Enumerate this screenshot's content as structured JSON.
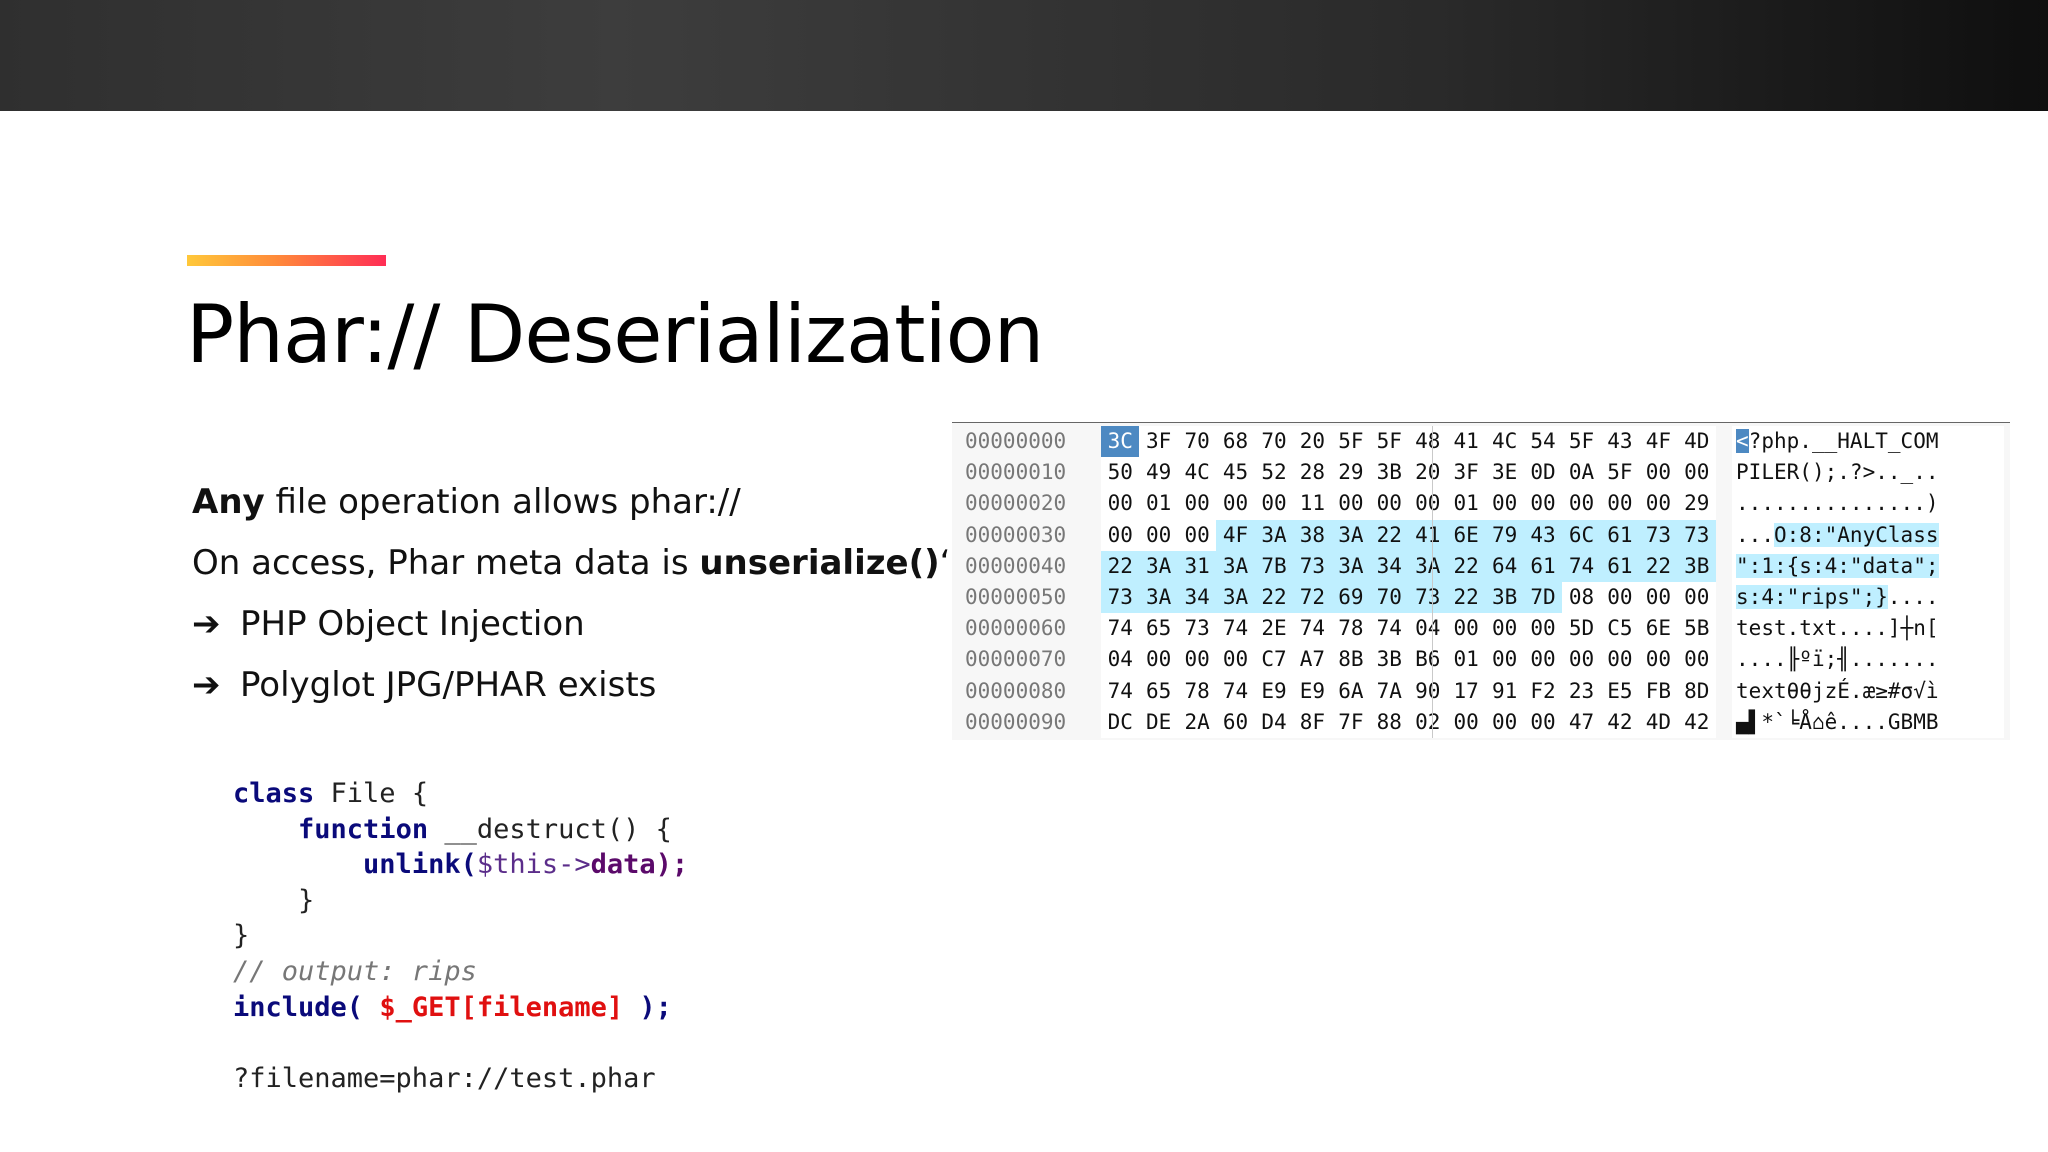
{
  "slide": {
    "title": "Phar:// Deserialization",
    "bullets": [
      {
        "prefix_bold": "Any",
        "text": " file operation allows phar://"
      },
      {
        "text": "On access, Phar meta data is ",
        "bold": "unserialize()",
        "suffix": "‘d"
      },
      {
        "arrow": "➔",
        "text": "PHP Object Injection"
      },
      {
        "arrow": "➔",
        "text": "Polyglot JPG/PHAR exists"
      }
    ],
    "code": {
      "line1_kw": "class",
      "line1_rest": " File {",
      "line2_kw": "function",
      "line2_rest": " __destruct() {",
      "line3_fn": "unlink(",
      "line3_var": "$this->",
      "line3_prop": "data);",
      "line3_end": ";",
      "line4": "}",
      "line5": "}",
      "line6_comment": "// output: rips",
      "line7_kw": "include(",
      "line7_red": "$_GET[filename]",
      "line7_end": " );",
      "line9": "?filename=phar://test.phar"
    }
  },
  "hex_view": {
    "offsets": [
      "00000000",
      "00000010",
      "00000020",
      "00000030",
      "00000040",
      "00000050",
      "00000060",
      "00000070",
      "00000080",
      "00000090"
    ],
    "rows": [
      [
        "3C",
        "3F",
        "70",
        "68",
        "70",
        "20",
        "5F",
        "5F",
        "48",
        "41",
        "4C",
        "54",
        "5F",
        "43",
        "4F",
        "4D"
      ],
      [
        "50",
        "49",
        "4C",
        "45",
        "52",
        "28",
        "29",
        "3B",
        "20",
        "3F",
        "3E",
        "0D",
        "0A",
        "5F",
        "00",
        "00"
      ],
      [
        "00",
        "01",
        "00",
        "00",
        "00",
        "11",
        "00",
        "00",
        "00",
        "01",
        "00",
        "00",
        "00",
        "00",
        "00",
        "29"
      ],
      [
        "00",
        "00",
        "00",
        "4F",
        "3A",
        "38",
        "3A",
        "22",
        "41",
        "6E",
        "79",
        "43",
        "6C",
        "61",
        "73",
        "73"
      ],
      [
        "22",
        "3A",
        "31",
        "3A",
        "7B",
        "73",
        "3A",
        "34",
        "3A",
        "22",
        "64",
        "61",
        "74",
        "61",
        "22",
        "3B"
      ],
      [
        "73",
        "3A",
        "34",
        "3A",
        "22",
        "72",
        "69",
        "70",
        "73",
        "22",
        "3B",
        "7D",
        "08",
        "00",
        "00",
        "00"
      ],
      [
        "74",
        "65",
        "73",
        "74",
        "2E",
        "74",
        "78",
        "74",
        "04",
        "00",
        "00",
        "00",
        "5D",
        "C5",
        "6E",
        "5B"
      ],
      [
        "04",
        "00",
        "00",
        "00",
        "C7",
        "A7",
        "8B",
        "3B",
        "B6",
        "01",
        "00",
        "00",
        "00",
        "00",
        "00",
        "00"
      ],
      [
        "74",
        "65",
        "78",
        "74",
        "E9",
        "E9",
        "6A",
        "7A",
        "90",
        "17",
        "91",
        "F2",
        "23",
        "E5",
        "FB",
        "8D"
      ],
      [
        "DC",
        "DE",
        "2A",
        "60",
        "D4",
        "8F",
        "7F",
        "88",
        "02",
        "00",
        "00",
        "00",
        "47",
        "42",
        "4D",
        "42"
      ]
    ],
    "ascii": [
      "<?php.__HALT_COM",
      "PILER();.?>.._..",
      "...............)",
      "...O:8:\"AnyClass",
      "\":1:{s:4:\"data\";",
      "s:4:\"rips\";}....",
      "test.txt....]┼n[",
      "....╟ºï;╢.......",
      "textθθjzÉ.æ≥#σ√ì",
      "▄▌*`╘Å⌂ê....GBMB"
    ],
    "colors": {
      "selection": "#bfefff",
      "cursor": "#4d89c2"
    }
  }
}
